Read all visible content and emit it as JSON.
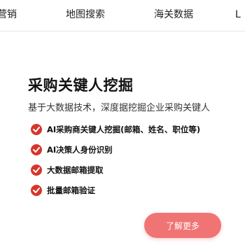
{
  "nav": {
    "items": [
      "营销",
      "地图搜索",
      "海关数据",
      "L"
    ]
  },
  "hero": {
    "title": "采购关键人挖掘",
    "subtitle": "基于大数据技术，深度据挖掘企业采购关键人",
    "features": [
      "AI采购商关键人挖掘(邮箱、姓名、职位等)",
      "AI决策人身份识别",
      "大数据邮箱提取",
      "批量邮箱验证"
    ],
    "cta_label": "了解更多"
  },
  "colors": {
    "accent": "#d8352b",
    "cta_background": "#f07474"
  }
}
